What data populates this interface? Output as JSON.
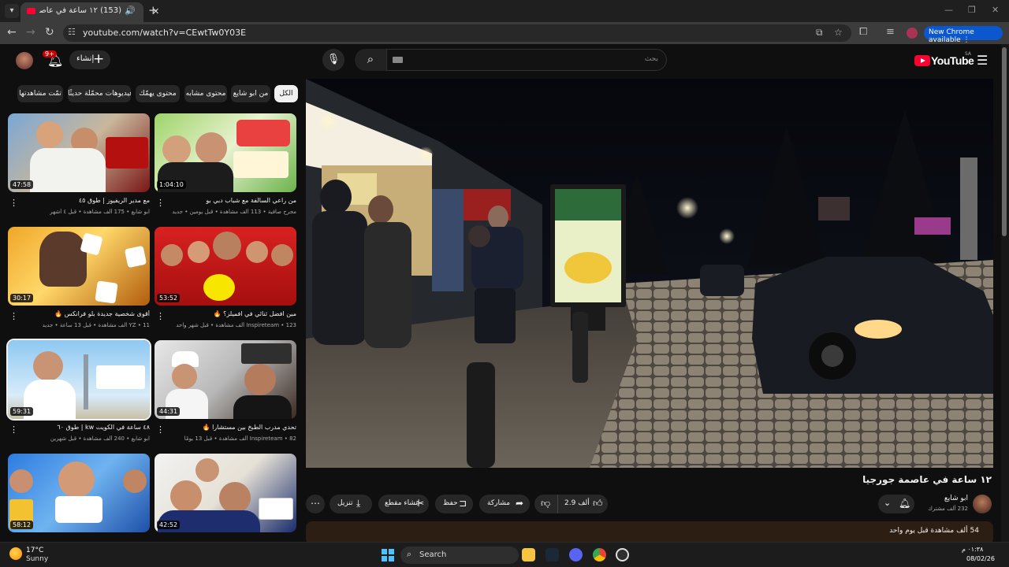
{
  "browser": {
    "tab": {
      "title": "١٢ ساعة في عاصمة جورجيا",
      "count": "(153)"
    },
    "url": "youtube.com/watch?v=CEwtTw0Y03E",
    "update_label": "New Chrome available"
  },
  "header": {
    "notifications_badge": "9+",
    "create_label": "إنشاء",
    "search_placeholder": "بحث",
    "logo_text": "YouTube",
    "logo_region": "SA"
  },
  "chips": [
    "الكل",
    "من ابو شايع",
    "محتوى مشابه",
    "محتوى يهمّك",
    "فيديوهات محمّلة حديثًا",
    "تمّت مشاهدتها"
  ],
  "related": [
    {
      "duration": "47:58",
      "title": "مع مدير الريفيوز | طوق ٤٥",
      "meta": "ابو شايع • 175 ألف مشاهدة • قبل ٤ أشهر"
    },
    {
      "duration": "1:04:10",
      "title": "من راعي السالفة مع شباب دبي بو",
      "meta": "مجرح صافية • 113 ألف مشاهدة • قبل يومين • جديد"
    },
    {
      "duration": "30:17",
      "title": "أقوى شخصية جديدة بلو فرانكس 🔥",
      "meta": "YZ • 11 ألف مشاهدة • قبل 13 ساعة • جديد"
    },
    {
      "duration": "53:52",
      "title": "مين افضل ثنائي في افميلز؟ 🔥",
      "meta": "Inspireteam • 123 ألف مشاهدة • قبل شهر واحد"
    },
    {
      "duration": "59:31",
      "title": "٤٨ ساعة في الكويت kw | طوق ٦٠",
      "meta": "ابو شايع • 240 ألف مشاهدة • قبل شهرين"
    },
    {
      "duration": "44:31",
      "title": "تحدي مدرب الطبخ بين مستشارا 🔥",
      "meta": "Inspireteam • 82 ألف مشاهدة • قبل 13 يومًا"
    },
    {
      "duration": "58:12",
      "title": "",
      "meta": ""
    },
    {
      "duration": "42:52",
      "title": "",
      "meta": ""
    }
  ],
  "video": {
    "title": "١٢ ساعة في عاصمة جورجيا",
    "channel": "ابو شايع",
    "subscribers": "232 ألف مشترك",
    "likes": "2.9 ألف",
    "share": "مشاركة",
    "save": "حفظ",
    "clip": "إنشاء مقطع",
    "download": "تنزيل",
    "views_line": "54 ألف مشاهدة قبل يوم واحد"
  },
  "taskbar": {
    "temperature": "17°C",
    "condition": "Sunny",
    "search_label": "Search",
    "time": "٠١:٣٨ م",
    "date": "08/02/26"
  },
  "colors": {
    "youtube_red": "#ff0033",
    "chrome_blue": "#0b57d0"
  }
}
